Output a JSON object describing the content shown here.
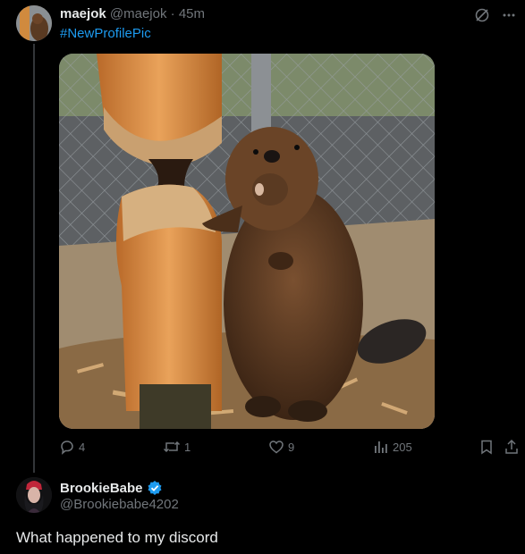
{
  "tweet": {
    "author_name": "maejok",
    "author_handle": "@maejok",
    "separator": "·",
    "time": "45m",
    "hashtag": "#NewProfilePic",
    "media_icon": "beaver-photo",
    "actions": {
      "replies": "4",
      "reposts": "1",
      "likes": "9",
      "views": "205"
    }
  },
  "reply": {
    "author_name": "BrookieBabe",
    "author_handle": "@Brookiebabe4202",
    "text": "What happened to my discord",
    "verified_color": "#1d9bf0"
  },
  "colors": {
    "background": "#000000",
    "text": "#e7e9ea",
    "muted": "#71767b",
    "accent": "#1d9bf0"
  }
}
